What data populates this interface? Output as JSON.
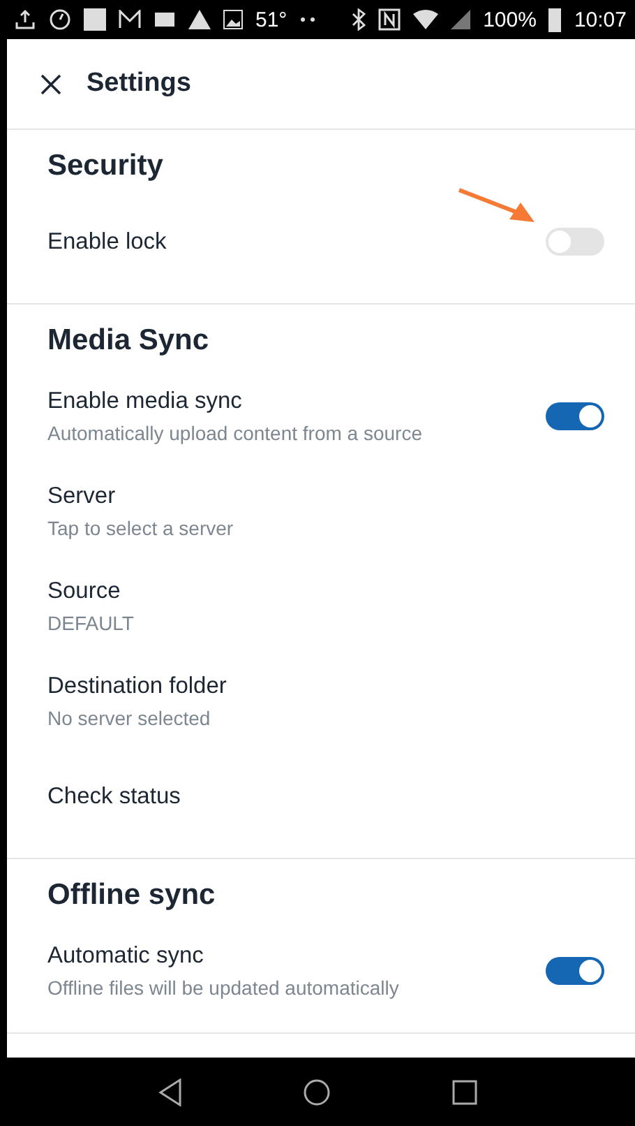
{
  "status_bar": {
    "temperature": "51°",
    "battery": "100%",
    "time": "10:07"
  },
  "header": {
    "title": "Settings"
  },
  "sections": [
    {
      "title": "Security",
      "items": [
        {
          "kind": "toggle",
          "label": "Enable lock",
          "on": false,
          "annotated": true
        }
      ]
    },
    {
      "title": "Media Sync",
      "items": [
        {
          "kind": "toggle",
          "label": "Enable media sync",
          "subtitle": "Automatically upload content from a source",
          "on": true
        },
        {
          "kind": "link",
          "label": "Server",
          "subtitle": "Tap to select a server"
        },
        {
          "kind": "link",
          "label": "Source",
          "subtitle": "DEFAULT"
        },
        {
          "kind": "link",
          "label": "Destination folder",
          "subtitle": "No server selected"
        },
        {
          "kind": "link",
          "label": "Check status"
        }
      ]
    },
    {
      "title": "Offline sync",
      "items": [
        {
          "kind": "toggle",
          "label": "Automatic sync",
          "subtitle": "Offline files will be updated automatically",
          "on": true
        }
      ]
    }
  ]
}
